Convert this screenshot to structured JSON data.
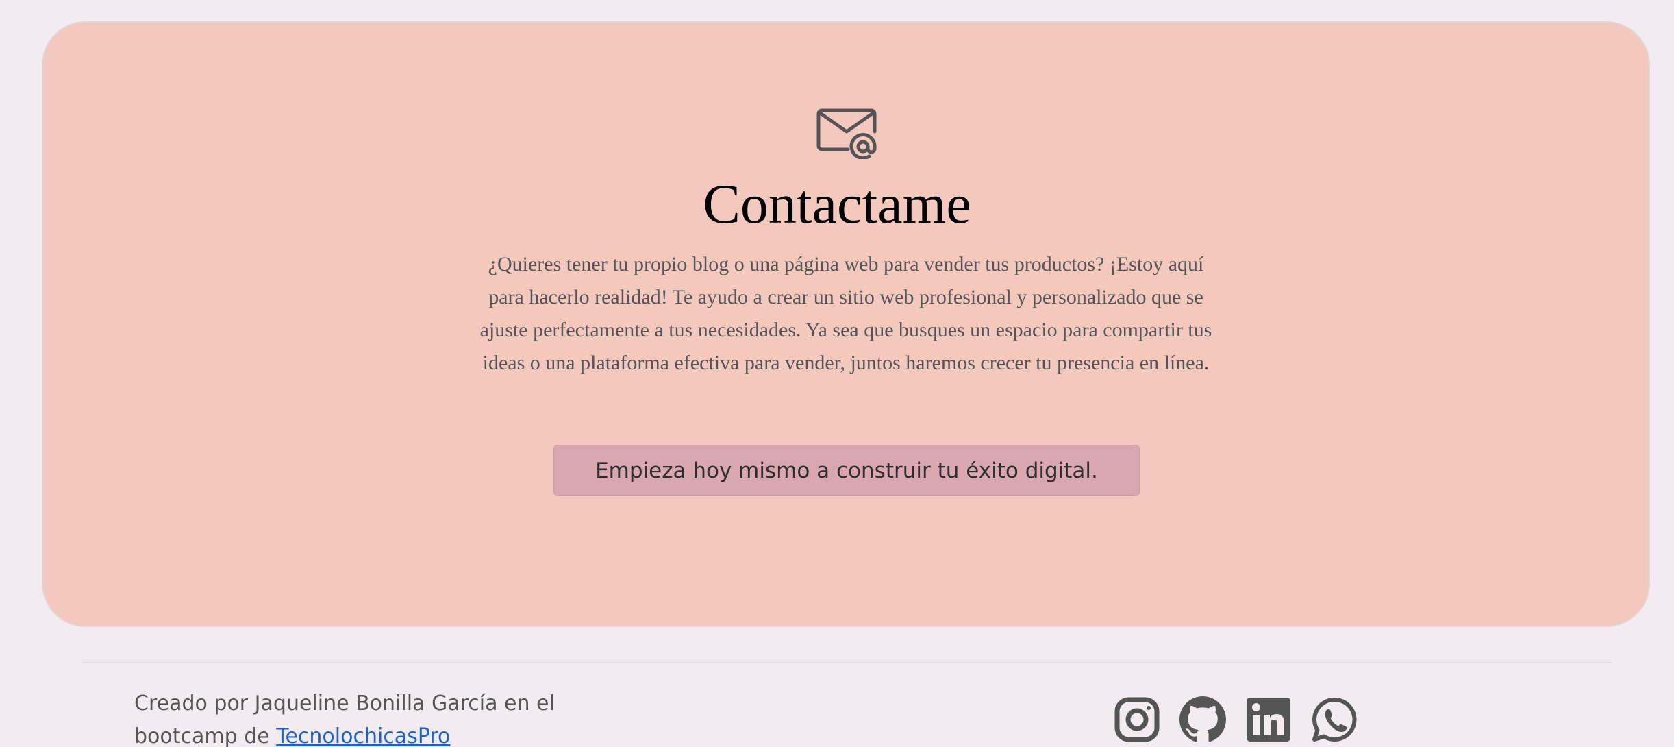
{
  "contact": {
    "icon": "envelope-at-icon",
    "title": "Contactame",
    "description": "¿Quieres tener tu propio blog o una página web para vender tus productos? ¡Estoy aquí para hacerlo realidad! Te ayudo a crear un sitio web profesional y personalizado que se ajuste perfectamente a tus necesidades. Ya sea que busques un espacio para compartir tus ideas o una plataforma efectiva para vender, juntos haremos crecer tu presencia en línea.",
    "button_label": "Empieza hoy mismo a construir tu éxito digital."
  },
  "footer": {
    "credit_text": "Creado por Jaqueline Bonilla García en el bootcamp de ",
    "credit_link": "TecnolochicasPro",
    "social": [
      {
        "icon": "instagram-icon"
      },
      {
        "icon": "github-icon"
      },
      {
        "icon": "linkedin-icon"
      },
      {
        "icon": "whatsapp-icon"
      }
    ]
  },
  "colors": {
    "page_background": "#f2ecf0",
    "card_background": "#f2c9bc",
    "button_background": "#d9a7b0",
    "link": "#1a5fd6",
    "icon": "#555555"
  }
}
